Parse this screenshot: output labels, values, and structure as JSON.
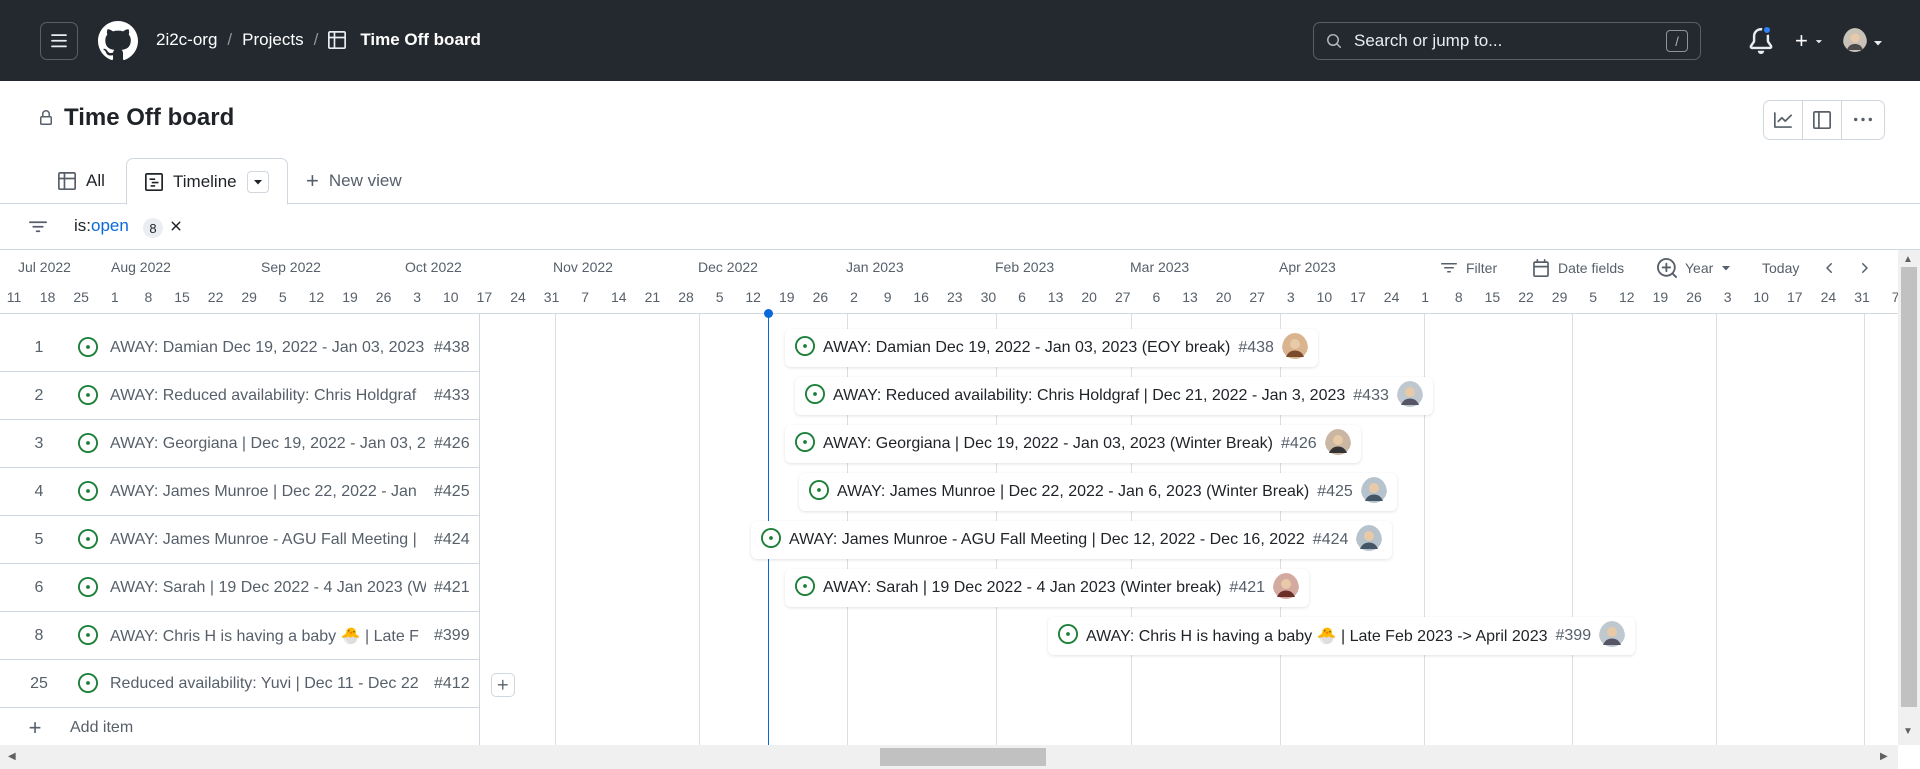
{
  "header": {
    "org": "2i2c-org",
    "projects": "Projects",
    "board": "Time Off board",
    "search_placeholder": "Search or jump to...",
    "search_shortcut": "/"
  },
  "page": {
    "title": "Time Off board"
  },
  "tabs": [
    {
      "label": "All"
    },
    {
      "label": "Timeline"
    },
    {
      "label": "New view"
    }
  ],
  "filter": {
    "key": "is:",
    "value": "open",
    "count": "8"
  },
  "timeline": {
    "months": [
      "Jul 2022",
      "Aug 2022",
      "Sep 2022",
      "Oct 2022",
      "Nov 2022",
      "Dec 2022",
      "Jan 2023",
      "Feb 2023",
      "Mar 2023",
      "Apr 2023"
    ],
    "days": [
      "11",
      "18",
      "25",
      "1",
      "8",
      "15",
      "22",
      "29",
      "5",
      "12",
      "19",
      "26",
      "3",
      "10",
      "17",
      "24",
      "31",
      "7",
      "14",
      "21",
      "28",
      "5",
      "12",
      "19",
      "26",
      "2",
      "9",
      "16",
      "23",
      "30",
      "6",
      "13",
      "20",
      "27",
      "6",
      "13",
      "20",
      "27",
      "3",
      "10",
      "17",
      "24",
      "1",
      "8",
      "15",
      "22",
      "29",
      "5",
      "12",
      "19",
      "26",
      "3",
      "10",
      "17",
      "24",
      "31",
      "7"
    ],
    "controls": {
      "filter": "Filter",
      "date_fields": "Date fields",
      "zoom": "Year",
      "today": "Today"
    },
    "add_item": "Add item"
  },
  "rows": [
    {
      "num": "1",
      "title": "AWAY: Damian Dec 19, 2022 - Jan 03, 2023",
      "ref": "#438",
      "bar_title": "AWAY: Damian Dec 19, 2022 - Jan 03, 2023 (EOY break)",
      "bar_ref": "#438"
    },
    {
      "num": "2",
      "title": "AWAY: Reduced availability: Chris Holdgraf",
      "ref": "#433",
      "bar_title": "AWAY: Reduced availability: Chris Holdgraf | Dec 21, 2022 - Jan 3, 2023",
      "bar_ref": "#433"
    },
    {
      "num": "3",
      "title": "AWAY: Georgiana | Dec 19, 2022 - Jan 03, 2",
      "ref": "#426",
      "bar_title": "AWAY: Georgiana | Dec 19, 2022 - Jan 03, 2023 (Winter Break)",
      "bar_ref": "#426"
    },
    {
      "num": "4",
      "title": "AWAY: James Munroe | Dec 22, 2022 - Jan",
      "ref": "#425",
      "bar_title": "AWAY: James Munroe | Dec 22, 2022 - Jan 6, 2023 (Winter Break)",
      "bar_ref": "#425"
    },
    {
      "num": "5",
      "title": "AWAY: James Munroe - AGU Fall Meeting |",
      "ref": "#424",
      "bar_title": "AWAY: James Munroe - AGU Fall Meeting | Dec 12, 2022 - Dec 16, 2022",
      "bar_ref": "#424"
    },
    {
      "num": "6",
      "title": "AWAY: Sarah | 19 Dec 2022 - 4 Jan 2023 (W",
      "ref": "#421",
      "bar_title": "AWAY: Sarah | 19 Dec 2022 - 4 Jan 2023 (Winter break)",
      "bar_ref": "#421"
    },
    {
      "num": "8",
      "title": "AWAY: Chris H is having a baby 🐣 | Late F",
      "ref": "#399",
      "bar_title": "AWAY: Chris H is having a baby 🐣 | Late Feb 2023 -> April 2023",
      "bar_ref": "#399"
    },
    {
      "num": "25",
      "title": "Reduced availability: Yuvi | Dec 11 - Dec 22",
      "ref": "#412",
      "bar_title": "",
      "bar_ref": ""
    }
  ],
  "colors": {
    "header_bg": "#24292f",
    "accent": "#0969da",
    "open_issue": "#1a7f37"
  }
}
